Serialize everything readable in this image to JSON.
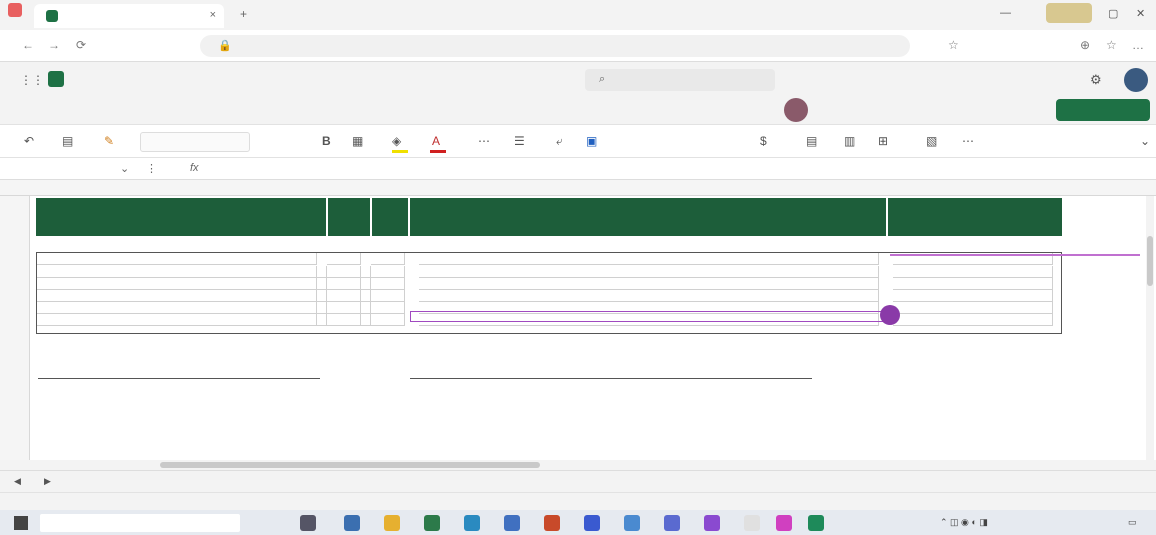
{
  "browser": {
    "tab_title": "",
    "tab_close": "×",
    "new_tab": "+",
    "minimize": "—",
    "maximize": "▢",
    "close": "✕",
    "back": "←",
    "forward": "→",
    "refresh": "⟳",
    "url": "",
    "address_actions": [
      "",
      "☆"
    ],
    "toolbar_icons": [
      "⊕",
      "☆",
      "…"
    ]
  },
  "excel": {
    "document_title": "",
    "search_placeholder": "",
    "name_box": "",
    "formula": ""
  },
  "ribbon": {
    "tabs": [
      "",
      "",
      "",
      "",
      "",
      "",
      "",
      "",
      "",
      "",
      "",
      ""
    ],
    "comments_label": "",
    "editing_label": "",
    "share_label": ""
  },
  "toolbar": {
    "undo": "↶",
    "clipboard": "▤",
    "format_painter": "✎",
    "font_name": "",
    "font_size": "",
    "number_format": "",
    "bold": "B"
  },
  "grid": {
    "columns": [
      "",
      "",
      "",
      "",
      "",
      ""
    ],
    "rows": [
      "",
      "",
      "",
      "",
      "",
      "",
      "",
      "",
      "",
      "",
      "",
      "",
      "",
      "",
      "",
      "",
      "",
      "",
      "",
      ""
    ],
    "header": {
      "col1": "",
      "col2": "",
      "col3": "",
      "col4": "",
      "col5": ""
    },
    "subtitle": "",
    "table_header": {
      "c1": "",
      "c2": "",
      "c3": "",
      "c4": "",
      "c5": ""
    },
    "table_rows": [
      {
        "c1": "",
        "c1b": "",
        "c2": "",
        "c2b": "",
        "c3": "",
        "c4": "",
        "c5": ""
      },
      {
        "c1": "",
        "c1b": "",
        "c2": "",
        "c2b": "",
        "c3": "",
        "c4": "",
        "c5": ""
      },
      {
        "c1": "",
        "c1b": "",
        "c2": "",
        "c2b": "",
        "c3": "",
        "c4": "",
        "c5": ""
      },
      {
        "c1": "",
        "c1b": "",
        "c2": "",
        "c2b": "",
        "c3": "",
        "c4": "",
        "c5": ""
      },
      {
        "c1": "",
        "c1b": "",
        "c2": "",
        "c2b": "",
        "c3": "",
        "c4": "",
        "c5": ""
      }
    ],
    "signatures": [
      {
        "name": "",
        "role": "",
        "place": ""
      },
      {
        "name": "",
        "role": "",
        "place": ""
      }
    ]
  },
  "sheet_tabs": [
    "",
    "",
    "",
    "",
    "",
    "",
    "",
    "",
    "",
    ""
  ],
  "sheet_nav": [
    "◀",
    "▶"
  ],
  "status": {
    "left1": "",
    "left2": "",
    "right1": "",
    "right2": ""
  },
  "taskbar": {
    "search_placeholder": "",
    "tray_temp": "",
    "tray_time": ""
  },
  "colors": {
    "accent": "#1e7145",
    "header_green": "#1d5e3a",
    "selection_purple": "#a04ac0"
  }
}
